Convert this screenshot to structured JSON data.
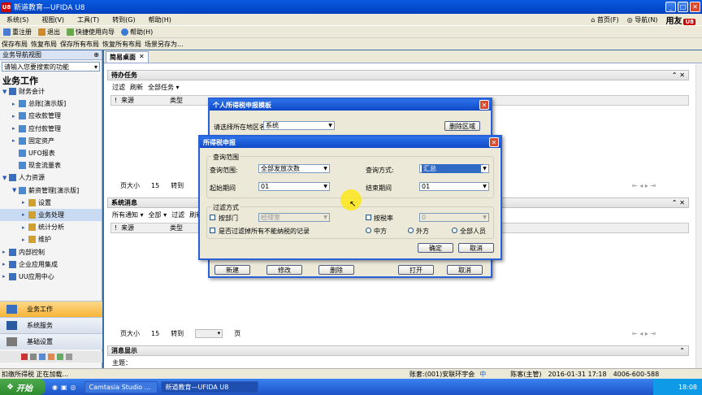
{
  "window": {
    "title": "新道教育—UFIDA U8",
    "logo": "U8"
  },
  "menu": {
    "items": [
      "系统(S)",
      "视图(V)",
      "工具(T)",
      "转到(G)",
      "帮助(H)"
    ],
    "right": {
      "home": "首页(F)",
      "nav": "导航(N)",
      "brand": "用友"
    }
  },
  "toolbar1": {
    "items": [
      "重注册",
      "退出",
      "快捷使用向导",
      "帮助(H)"
    ]
  },
  "toolbar2": {
    "items": [
      "保存布局",
      "恢复布局",
      "保存所有布局",
      "恢复所有布局",
      "场景另存为..."
    ]
  },
  "sidebar": {
    "header": "业务导航视图",
    "search_placeholder": "请输入您要搜索的功能",
    "title": "业务工作",
    "tree": [
      {
        "label": "财务会计",
        "level": 0,
        "arrow": "▼"
      },
      {
        "label": "总账[演示版]",
        "level": 1,
        "arrow": "▸"
      },
      {
        "label": "应收款管理",
        "level": 1,
        "arrow": "▸"
      },
      {
        "label": "应付款管理",
        "level": 1,
        "arrow": "▸"
      },
      {
        "label": "固定资产",
        "level": 1,
        "arrow": "▸"
      },
      {
        "label": "UFO报表",
        "level": 1,
        "arrow": ""
      },
      {
        "label": "现金流量表",
        "level": 1,
        "arrow": ""
      },
      {
        "label": "人力资源",
        "level": 0,
        "arrow": "▼"
      },
      {
        "label": "薪资管理[演示版]",
        "level": 1,
        "arrow": "▼"
      },
      {
        "label": "设置",
        "level": 2,
        "arrow": "▸"
      },
      {
        "label": "业务处理",
        "level": 2,
        "arrow": "▸"
      },
      {
        "label": "统计分析",
        "level": 2,
        "arrow": "▸"
      },
      {
        "label": "维护",
        "level": 2,
        "arrow": "▸"
      },
      {
        "label": "内部控制",
        "level": 0,
        "arrow": "▸"
      },
      {
        "label": "企业应用集成",
        "level": 0,
        "arrow": "▸"
      },
      {
        "label": "UU应用中心",
        "level": 0,
        "arrow": "▸"
      }
    ],
    "bottom_buttons": [
      "业务工作",
      "系统服务",
      "基础设置"
    ]
  },
  "main": {
    "tab": "简易桌面",
    "todo": {
      "title": "待办任务",
      "tools": [
        "过滤",
        "刷新",
        "全部任务 ▾"
      ],
      "cols": [
        "!",
        "来源",
        "类型"
      ],
      "pager": {
        "size_label": "页大小",
        "size": "15",
        "goto": "转到"
      }
    },
    "messages": {
      "title": "系统消息",
      "tools": [
        "所有通知 ▾",
        "全部 ▾",
        "过滤",
        "刷新"
      ],
      "cols": [
        "!",
        "来源",
        "类型"
      ],
      "pager": {
        "size_label": "页大小",
        "size": "15",
        "goto": "转到",
        "page": "页"
      }
    },
    "display": {
      "title": "消息显示",
      "subject": "主题："
    }
  },
  "dialog_tax_template": {
    "title": "个人所得税申报模板",
    "region_label": "请选择所在地区名",
    "region_value": "系统",
    "delete_region": "删除区域",
    "buttons": [
      "新建",
      "修改",
      "删除",
      "打开",
      "取消"
    ]
  },
  "dialog_tax_report": {
    "title": "所得税申报",
    "query_group": "查询范围",
    "query_range_label": "查询范围:",
    "query_range_value": "全部发放次数",
    "query_mode_label": "查询方式:",
    "query_mode_value": "汇总",
    "start_label": "起始期间",
    "start_value": "01",
    "end_label": "结束期间",
    "end_value": "01",
    "filter_group": "过滤方式",
    "by_dept": "按部门",
    "dept_value": "经理室",
    "by_rate": "按税率",
    "rate_value": "0",
    "exclude_label": "是否过滤掉所有不能纳税的记录",
    "radios": [
      "中方",
      "外方",
      "全部人员"
    ],
    "ok": "确定",
    "cancel": "取消"
  },
  "status": {
    "left": "扣缴所得税 正在加载...",
    "account": "账套:(001)安联环宇会",
    "ime": "中",
    "user": "陈客(主管)",
    "datetime": "2016-01-31 17:18",
    "phone": "4006-600-588"
  },
  "taskbar": {
    "start": "开始",
    "tasks": [
      "Camtasia Studio ...",
      "新道教育—UFIDA U8"
    ],
    "clock": "18:08"
  }
}
